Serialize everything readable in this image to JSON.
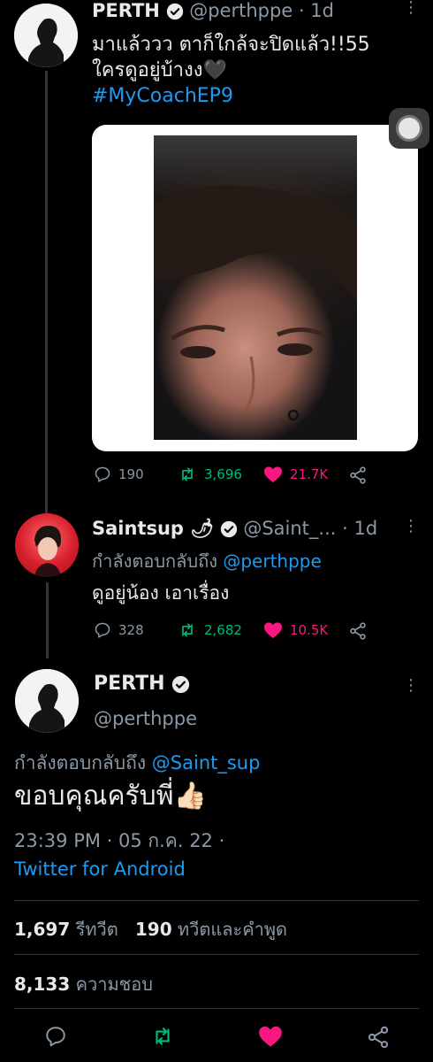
{
  "tweet1": {
    "name": "PERTH",
    "handle": "@perthppe",
    "time": "· 1d",
    "text_line1": "มาแล้ววว ตาก็ใกล้จะปิดแล้ว!!55",
    "text_line2": "ใครดูอยู่บ้างง🖤",
    "hashtag": "#MyCoachEP9",
    "replies": "190",
    "retweets": "3,696",
    "likes": "21.7K"
  },
  "tweet2": {
    "name": "Saintsup 🌶",
    "handle": "@Saint_...",
    "time": "· 1d",
    "reply_prefix": "กำลังตอบกลับถึง",
    "reply_to": "@perthppe",
    "text": "ดูอยู่น้อง เอาเรื่อง",
    "replies": "328",
    "retweets": "2,682",
    "likes": "10.5K"
  },
  "main_tweet": {
    "name": "PERTH",
    "handle": "@perthppe",
    "reply_prefix": "กำลังตอบกลับถึง",
    "reply_to": "@Saint_sup",
    "text": "ขอบคุณครับพี่👍🏻",
    "timestamp": "23:39 PM · 05 ก.ค. 22 ·",
    "source": "Twitter for Android",
    "retweet_count": "1,697",
    "retweet_label": "รีทวีต",
    "quote_count": "190",
    "quote_label": "ทวีตและคำพูด",
    "like_count": "8,133",
    "like_label": "ความชอบ"
  },
  "colors": {
    "background": "#000000",
    "link": "#1d9bf0",
    "retweet": "#00ba7c",
    "like": "#f91880",
    "muted": "#8b98a5"
  },
  "icons": [
    "reply-icon",
    "retweet-icon",
    "heart-icon",
    "share-icon",
    "verified-icon",
    "more-icon"
  ]
}
